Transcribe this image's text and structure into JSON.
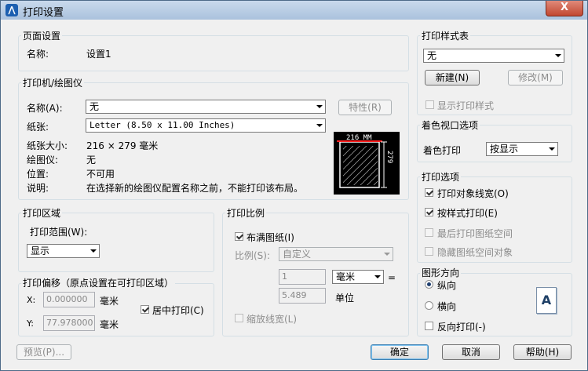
{
  "window": {
    "title": "打印设置",
    "close": "X"
  },
  "page_setup": {
    "title": "页面设置",
    "name_label": "名称:",
    "name_value": "设置1"
  },
  "printer": {
    "title": "打印机/绘图仪",
    "name_label": "名称(A):",
    "name_value": "无",
    "properties_btn": "特性(R)",
    "paper_label": "纸张:",
    "paper_value": "Letter (8.50 x 11.00 Inches)",
    "size_label": "纸张大小:",
    "size_value": "216 × 279  毫米",
    "plotter_label": "绘图仪:",
    "plotter_value": "无",
    "location_label": "位置:",
    "location_value": "不可用",
    "desc_label": "说明:",
    "desc_value": "在选择新的绘图仪配置名称之前，不能打印该布局。",
    "preview_width": "216 MM",
    "preview_height": "279"
  },
  "plot_area": {
    "title": "打印区域",
    "range_label": "打印范围(W):",
    "range_value": "显示"
  },
  "plot_offset": {
    "title": "打印偏移（原点设置在可打印区域）",
    "x_label": "X:",
    "x_value": "0.000000",
    "y_label": "Y:",
    "y_value": "77.978000",
    "unit": "毫米",
    "center_label": "居中打印(C)"
  },
  "plot_scale": {
    "title": "打印比例",
    "fit_label": "布满图纸(I)",
    "scale_label": "比例(S):",
    "scale_value": "自定义",
    "value1": "1",
    "unit_value": "毫米",
    "equals": "=",
    "value2": "5.489",
    "unit_label": "单位",
    "lineweight_label": "缩放线宽(L)"
  },
  "style_table": {
    "title": "打印样式表",
    "value": "无",
    "new_btn": "新建(N)",
    "edit_btn": "修改(M)",
    "show_label": "显示打印样式"
  },
  "shaded": {
    "title": "着色视口选项",
    "label": "着色打印",
    "value": "按显示"
  },
  "options": {
    "title": "打印选项",
    "items": [
      "打印对象线宽(O)",
      "按样式打印(E)",
      "最后打印图纸空间",
      "隐藏图纸空间对象"
    ]
  },
  "orientation": {
    "title": "图形方向",
    "portrait": "纵向",
    "landscape": "横向",
    "reverse": "反向打印(-)",
    "icon_letter": "A"
  },
  "footer": {
    "preview_btn": "预览(P)...",
    "ok_btn": "确定",
    "cancel_btn": "取消",
    "help_btn": "帮助(H)"
  }
}
